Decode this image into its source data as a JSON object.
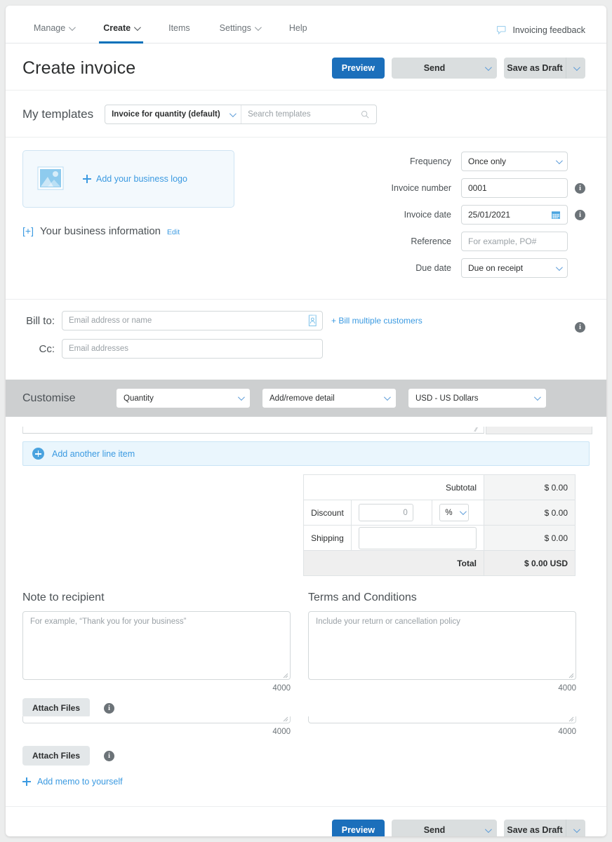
{
  "nav": {
    "items": [
      {
        "label": "Manage",
        "caret": true,
        "active": false
      },
      {
        "label": "Create",
        "caret": true,
        "active": true
      },
      {
        "label": "Items",
        "caret": false,
        "active": false
      },
      {
        "label": "Settings",
        "caret": true,
        "active": false
      },
      {
        "label": "Help",
        "caret": false,
        "active": false
      }
    ],
    "feedback_label": "Invoicing feedback",
    "feedback_icon": "speech-bubble-icon",
    "active_underline_color": "#0070ba"
  },
  "header": {
    "title": "Create invoice",
    "preview_label": "Preview",
    "send_label": "Send",
    "draft_label": "Save as Draft",
    "primary_color": "#1b6fbb",
    "secondary_color": "#dadedf"
  },
  "templates": {
    "label": "My templates",
    "selected": "Invoice for quantity (default)",
    "search_placeholder": "Search templates",
    "search_icon": "search-icon",
    "caret_icon": "chevron-down-icon"
  },
  "logo": {
    "cta": "Add your business logo",
    "plus_icon": "plus-icon",
    "image_icon": "image-placeholder-icon",
    "bg_color": "#f3f9fd",
    "border_color": "#cfe4f3"
  },
  "business_info": {
    "expander": "[+]",
    "label": "Your business information",
    "edit_label": "Edit"
  },
  "invoice_fields": [
    {
      "label": "Frequency",
      "value": "Once only",
      "type": "select",
      "info": false
    },
    {
      "label": "Invoice number",
      "value": "0001",
      "type": "text",
      "info": true
    },
    {
      "label": "Invoice date",
      "value": "25/01/2021",
      "type": "date",
      "info": true
    },
    {
      "label": "Reference",
      "value": "",
      "placeholder": "For example, PO#",
      "type": "text",
      "info": false
    },
    {
      "label": "Due date",
      "value": "Due on receipt",
      "type": "select",
      "info": false
    }
  ],
  "bill_to": {
    "label": "Bill to:",
    "placeholder": "Email address or name",
    "contact_icon": "contact-card-icon",
    "multiple_link": "+ Bill multiple customers",
    "cc_label": "Cc:",
    "cc_placeholder": "Email addresses"
  },
  "customise": {
    "label": "Customise",
    "selects": [
      {
        "value": "Quantity"
      },
      {
        "value": "Add/remove detail"
      },
      {
        "value": "USD - US Dollars"
      }
    ],
    "bar_color": "#cdcfd0"
  },
  "line_items": {
    "add_label": "Add another line item",
    "add_icon": "plus-circle-icon",
    "bar_bg": "#eaf6fd"
  },
  "totals": {
    "rows": [
      {
        "label": "Subtotal",
        "value": "$ 0.00"
      },
      {
        "label": "Discount",
        "value": "$ 0.00",
        "input_value": "0",
        "unit": "%"
      },
      {
        "label": "Shipping",
        "value": "$ 0.00",
        "input_value": ""
      },
      {
        "label": "Total",
        "value": "$ 0.00 USD"
      }
    ]
  },
  "note": {
    "title": "Note to recipient",
    "placeholder": "For example, “Thank you for your business”",
    "counter": "4000"
  },
  "terms": {
    "title": "Terms and Conditions",
    "placeholder": "Include your return or cancellation policy",
    "counter": "4000"
  },
  "attach": {
    "label": "Attach Files",
    "counter_left": "4000",
    "counter_right": "4000",
    "memo_label": "Add memo to yourself",
    "memo_icon": "plus-icon"
  },
  "footer": {
    "preview_label": "Preview",
    "send_label": "Send",
    "draft_label": "Save as Draft"
  }
}
